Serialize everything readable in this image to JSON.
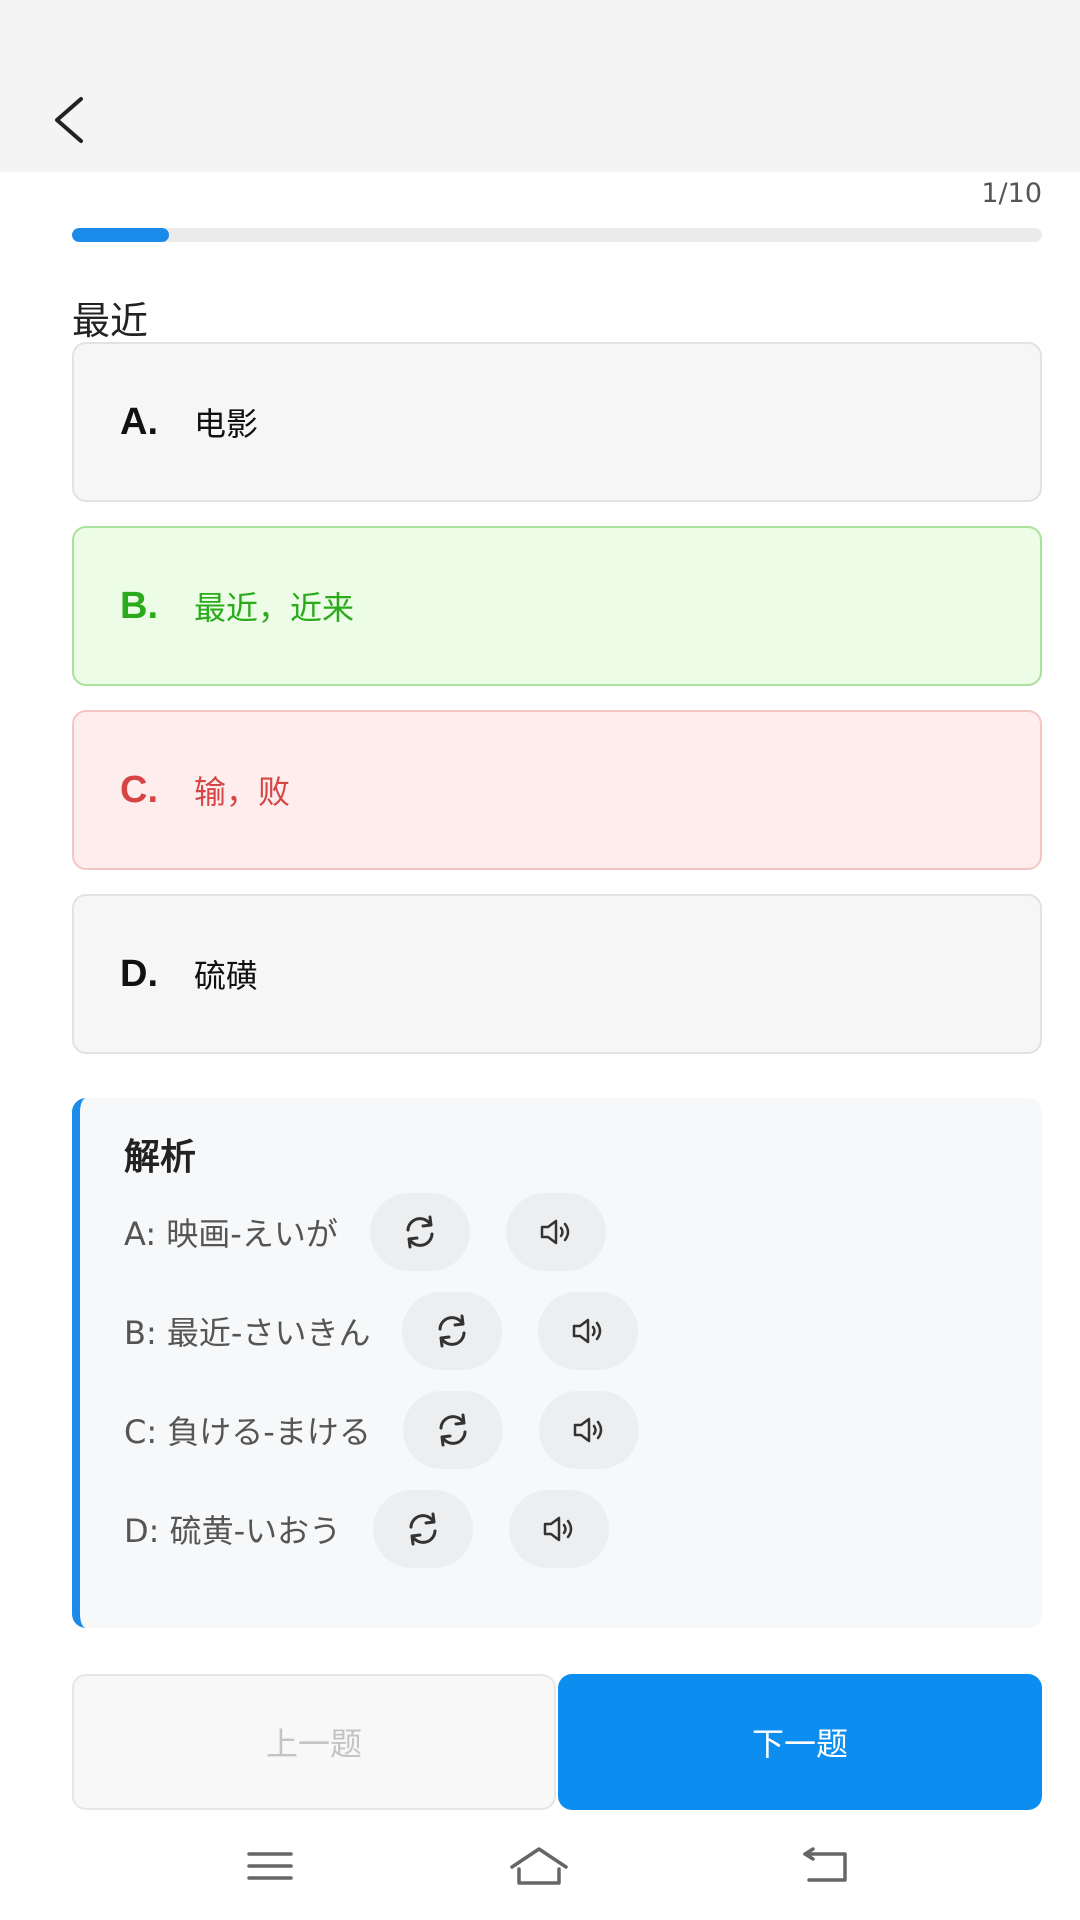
{
  "header": {
    "back_icon": "chevron-left-icon"
  },
  "progress": {
    "label": "1/10",
    "current": 1,
    "total": 10,
    "fraction": 0.1,
    "color": "#1a8be8"
  },
  "question": {
    "text": "最近"
  },
  "options": [
    {
      "letter": "A.",
      "text": "电影",
      "state": "neutral"
    },
    {
      "letter": "B.",
      "text": "最近，近来",
      "state": "correct"
    },
    {
      "letter": "C.",
      "text": "输，败",
      "state": "wrong"
    },
    {
      "letter": "D.",
      "text": "硫磺",
      "state": "neutral"
    }
  ],
  "analysis": {
    "title": "解析",
    "rows": [
      {
        "text": "A: 映画-えいが",
        "repeat_icon": "repeat-icon",
        "audio_icon": "speaker-icon"
      },
      {
        "text": "B: 最近-さいきん",
        "repeat_icon": "repeat-icon",
        "audio_icon": "speaker-icon"
      },
      {
        "text": "C: 負ける-まける",
        "repeat_icon": "repeat-icon",
        "audio_icon": "speaker-icon"
      },
      {
        "text": "D: 硫黄-いおう",
        "repeat_icon": "repeat-icon",
        "audio_icon": "speaker-icon"
      }
    ]
  },
  "buttons": {
    "prev_label": "上一题",
    "next_label": "下一题"
  },
  "navbar": {
    "menu_icon": "menu-icon",
    "home_icon": "home-icon",
    "back_icon": "return-icon"
  },
  "colors": {
    "accent": "#0b8ef0",
    "correct": "#2bab1c",
    "wrong": "#d54545"
  }
}
